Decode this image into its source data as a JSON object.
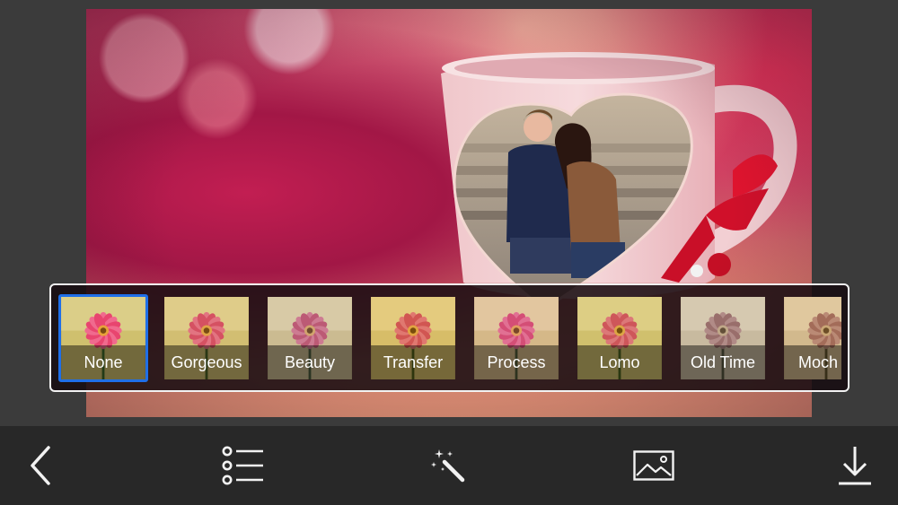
{
  "filters": {
    "selected_index": 0,
    "items": [
      {
        "label": "None",
        "tint": "#000000",
        "tint_opacity": 0.0
      },
      {
        "label": "Gorgeous",
        "tint": "#ffd9a0",
        "tint_opacity": 0.25
      },
      {
        "label": "Beauty",
        "tint": "#f4e3ea",
        "tint_opacity": 0.45
      },
      {
        "label": "Transfer",
        "tint": "#f3c46a",
        "tint_opacity": 0.35
      },
      {
        "label": "Process",
        "tint": "#f7b7d8",
        "tint_opacity": 0.3
      },
      {
        "label": "Lomo",
        "tint": "#d7c470",
        "tint_opacity": 0.3
      },
      {
        "label": "Old Time",
        "tint": "#c9bcae",
        "tint_opacity": 0.8
      },
      {
        "label": "Moch",
        "tint": "#b89d7a",
        "tint_opacity": 0.8
      }
    ]
  },
  "toolbar": {
    "items": [
      "back-icon",
      "list-icon",
      "magic-wand-icon",
      "image-icon",
      "download-icon"
    ]
  },
  "colors": {
    "selected_border": "#1f6fe8",
    "toolbar_bg": "#282828",
    "app_bg": "#3b3b3b",
    "icon": "#f2f2f2"
  }
}
